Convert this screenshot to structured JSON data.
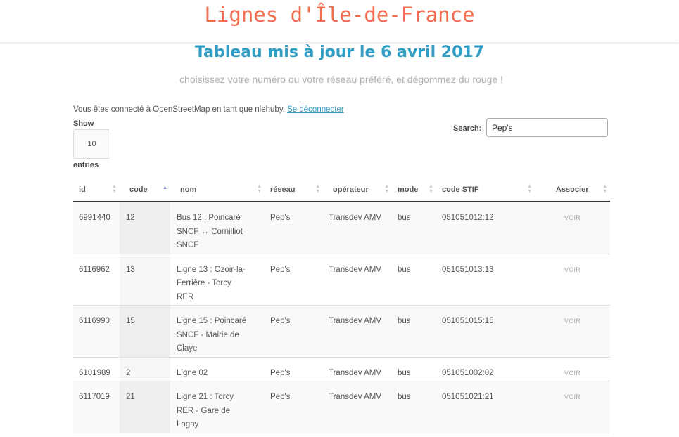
{
  "header": {
    "site_title": "Lignes d'Île-de-France"
  },
  "main": {
    "heading": "Tableau mis à jour le 6 avril 2017",
    "subtitle": "choisissez votre numéro ou votre réseau préféré, et dégommez du rouge !",
    "osm_status": "Vous êtes connecté à OpenStreetMap en tant que nlehuby.",
    "logout_link": "Se déconnecter"
  },
  "table_controls": {
    "show_label": "Show",
    "page_length": "10",
    "entries_label": "entries",
    "search_label": "Search:",
    "search_value": "Pep's"
  },
  "table": {
    "columns": [
      {
        "label": "id",
        "sort": "both"
      },
      {
        "label": "code",
        "sort": "asc"
      },
      {
        "label": "nom",
        "sort": "both"
      },
      {
        "label": "réseau",
        "sort": "both"
      },
      {
        "label": "opérateur",
        "sort": "both"
      },
      {
        "label": "mode",
        "sort": "both"
      },
      {
        "label": "code STIF",
        "sort": "both"
      },
      {
        "label": "Associer",
        "sort": "both"
      }
    ],
    "rows": [
      {
        "id": "6991440",
        "code": "12",
        "nom": "Bus 12 : Poincaré SNCF ↔ Cornilliot SNCF",
        "reseau": "Pep's",
        "operateur": "Transdev AMV",
        "mode": "bus",
        "code_stif": "051051012:12",
        "action": "VOIR"
      },
      {
        "id": "6116962",
        "code": "13",
        "nom": "Ligne 13 : Ozoir-la-Ferrière - Torcy RER",
        "reseau": "Pep's",
        "operateur": "Transdev AMV",
        "mode": "bus",
        "code_stif": "051051013:13",
        "action": "VOIR"
      },
      {
        "id": "6116990",
        "code": "15",
        "nom": "Ligne 15 : Poincaré SNCF - Mairie de Claye",
        "reseau": "Pep's",
        "operateur": "Transdev AMV",
        "mode": "bus",
        "code_stif": "051051015:15",
        "action": "VOIR"
      },
      {
        "id": "6101989",
        "code": "2",
        "nom": "Ligne 02",
        "reseau": "Pep's",
        "operateur": "Transdev AMV",
        "mode": "bus",
        "code_stif": "051051002:02",
        "action": "VOIR"
      },
      {
        "id": "6117019",
        "code": "21",
        "nom": "Ligne 21 : Torcy RER - Gare de Lagny",
        "reseau": "Pep's",
        "operateur": "Transdev AMV",
        "mode": "bus",
        "code_stif": "051051021:21",
        "action": "VOIR"
      }
    ]
  },
  "colors": {
    "title_accent": "#f26c4f",
    "heading_blue": "#2f9dc4",
    "sort_active": "#7a7fd0"
  }
}
